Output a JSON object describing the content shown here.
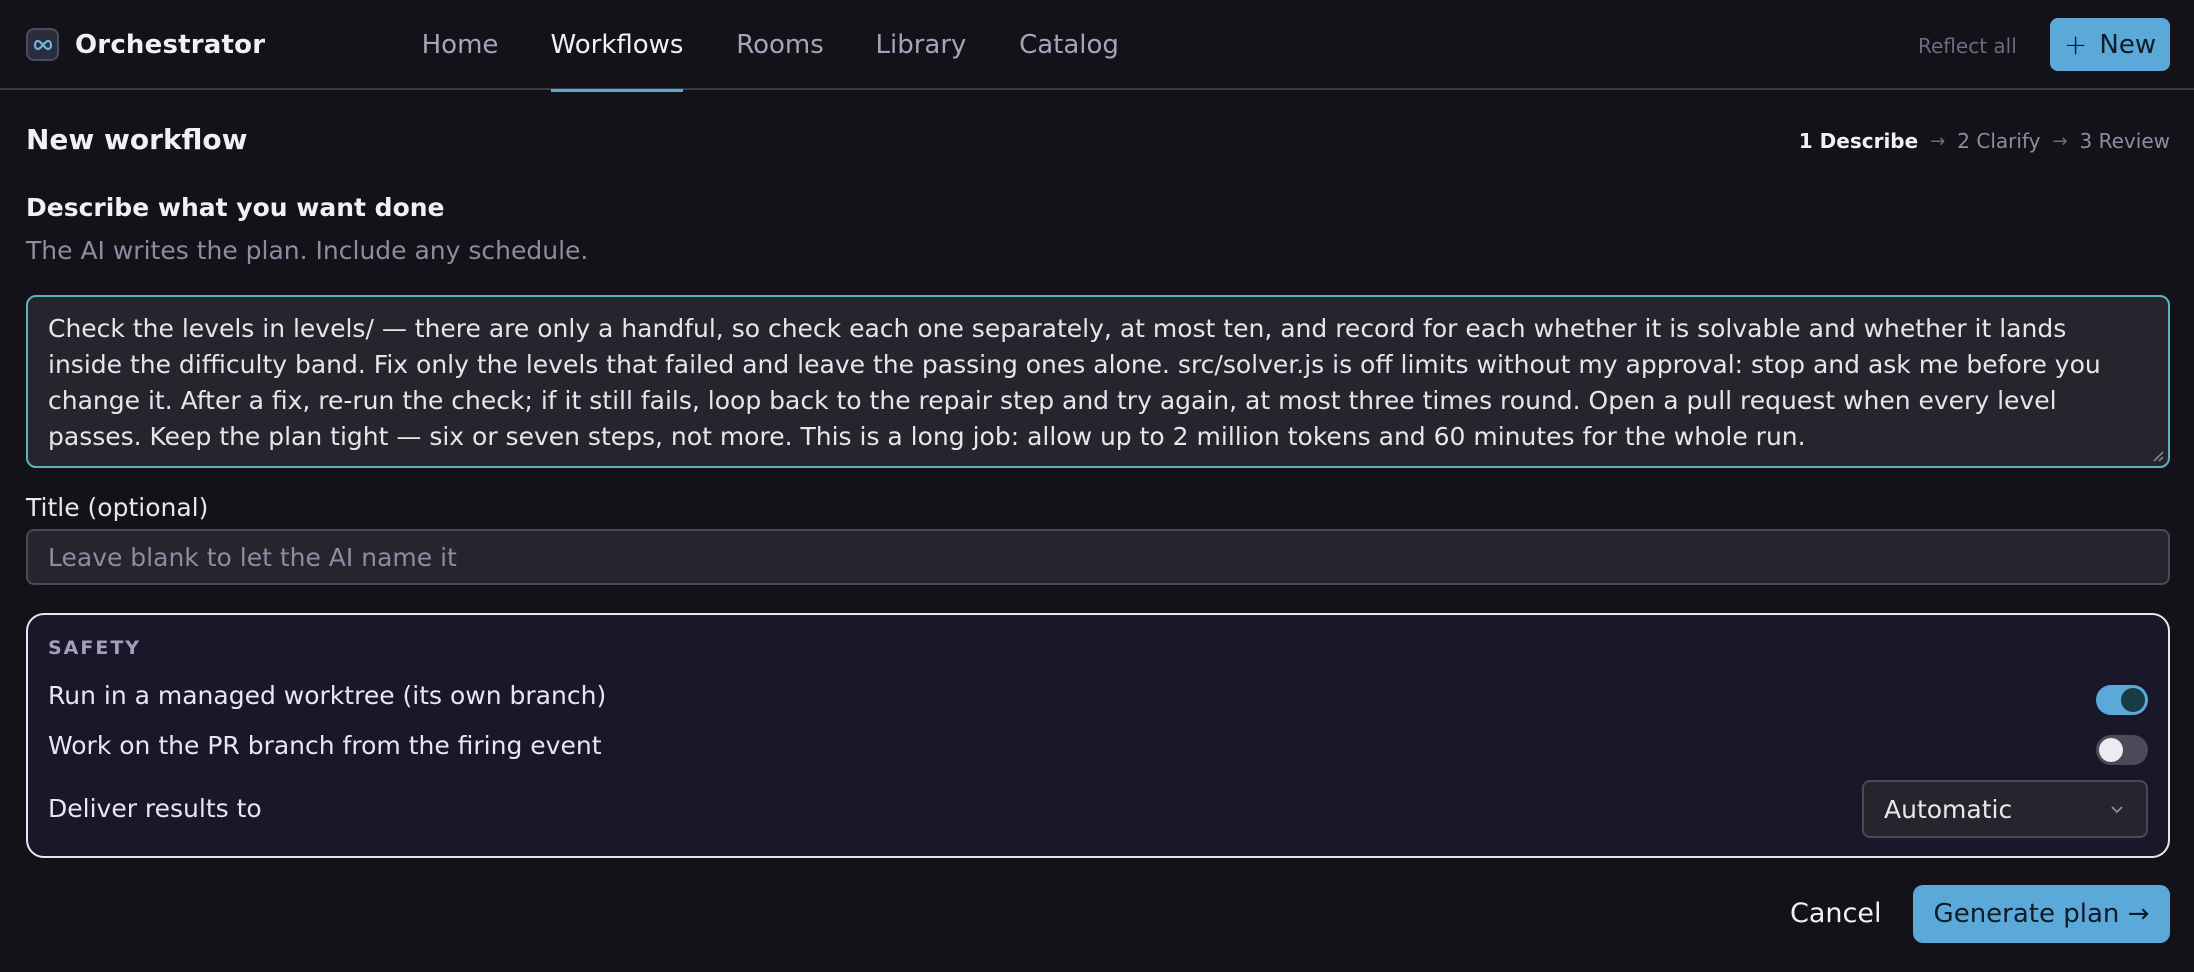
{
  "app": {
    "name": "Orchestrator",
    "logo_icon": "infinity-link-icon",
    "accent_color": "#5aa9d8",
    "focus_color": "#5bb3c2"
  },
  "nav": {
    "tabs": [
      {
        "label": "Home",
        "active": false
      },
      {
        "label": "Workflows",
        "active": true
      },
      {
        "label": "Rooms",
        "active": false
      },
      {
        "label": "Library",
        "active": false
      },
      {
        "label": "Catalog",
        "active": false
      }
    ]
  },
  "toolbar": {
    "reflect_label": "Reflect all",
    "new_label": "New",
    "new_icon": "plus-icon"
  },
  "page": {
    "title": "New workflow",
    "steps": [
      {
        "label": "1 Describe",
        "current": true
      },
      {
        "label": "2 Clarify",
        "current": false
      },
      {
        "label": "3 Review",
        "current": false
      }
    ],
    "step_separator_icon": "arrow-right-icon"
  },
  "describe": {
    "label": "Describe what you want done",
    "hint": "The AI writes the plan. Include any schedule.",
    "value": "Check the levels in levels/ — there are only a handful, so check each one separately, at most ten, and record for each whether it is solvable and whether it lands inside the difficulty band. Fix only the levels that failed and leave the passing ones alone. src/solver.js is off limits without my approval: stop and ask me before you change it. After a fix, re-run the check; if it still fails, loop back to the repair step and try again, at most three times round. Open a pull request when every level passes. Keep the plan tight — six or seven steps, not more. This is a long job: allow up to 2 million tokens and 60 minutes for the whole run."
  },
  "title_field": {
    "label": "Title (optional)",
    "value": "",
    "placeholder": "Leave blank to let the AI name it"
  },
  "safety": {
    "heading": "SAFETY",
    "options": [
      {
        "label": "Run in a managed worktree (its own branch)",
        "enabled": true
      },
      {
        "label": "Work on the PR branch from the firing event",
        "enabled": false
      }
    ],
    "deliver_label": "Deliver results to",
    "deliver_value": "Automatic",
    "deliver_icon": "chevron-down-icon"
  },
  "actions": {
    "cancel_label": "Cancel",
    "generate_label": "Generate plan →"
  }
}
